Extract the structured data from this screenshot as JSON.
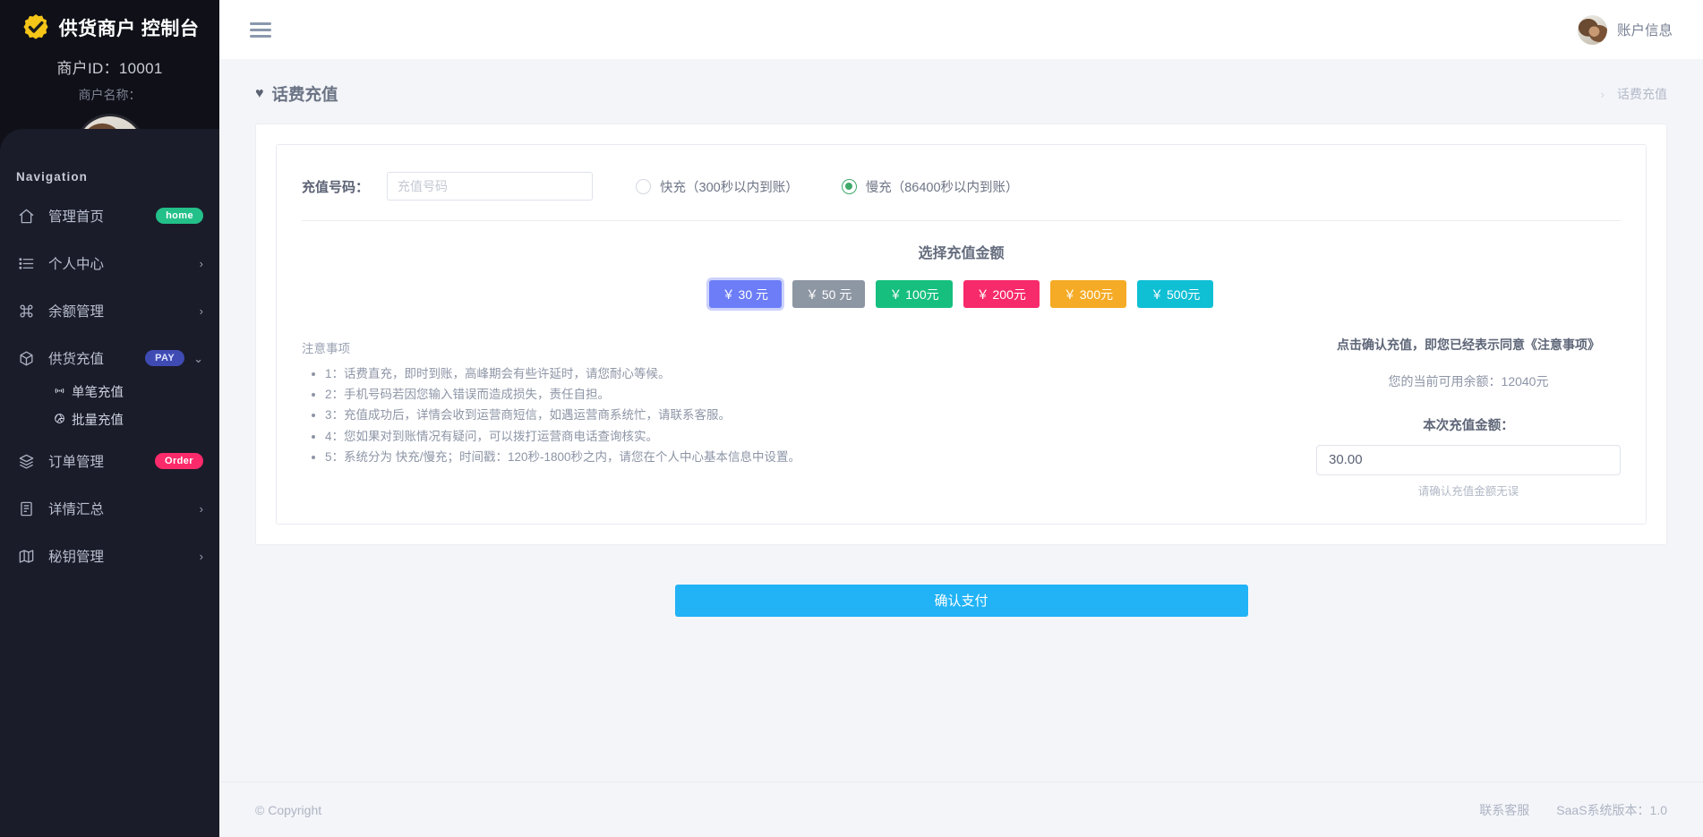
{
  "sidebar": {
    "brand_title": "供货商户 控制台",
    "logo_icon": "gear-check-icon",
    "merchant_id": "商户ID：10001",
    "merchant_name": "商户名称：",
    "nav_heading": "Navigation",
    "items": [
      {
        "label": "管理首页",
        "icon": "home-icon",
        "badge": "home",
        "badge_type": "home",
        "caret": ""
      },
      {
        "label": "个人中心",
        "icon": "list-icon",
        "badge": "",
        "badge_type": "",
        "caret": "›"
      },
      {
        "label": "余额管理",
        "icon": "command-icon",
        "badge": "",
        "badge_type": "",
        "caret": "›"
      },
      {
        "label": "供货充值",
        "icon": "box-icon",
        "badge": "PAY",
        "badge_type": "pay",
        "caret": "⌄"
      },
      {
        "label": "订单管理",
        "icon": "layers-icon",
        "badge": "Order",
        "badge_type": "order",
        "caret": ""
      },
      {
        "label": "详情汇总",
        "icon": "document-icon",
        "badge": "",
        "badge_type": "",
        "caret": "›"
      },
      {
        "label": "秘钥管理",
        "icon": "map-icon",
        "badge": "",
        "badge_type": "",
        "caret": "›"
      }
    ],
    "subitems": [
      {
        "label": "单笔充值",
        "glyph": "((↑))"
      },
      {
        "label": "批量充值",
        "glyph": "◎"
      }
    ]
  },
  "topbar": {
    "menu_icon": "hamburger-icon",
    "account_label": "账户信息",
    "avatar_icon": "user-avatar"
  },
  "page": {
    "title": "话费充值",
    "title_icon": "heart-icon",
    "breadcrumb_sep": "›",
    "breadcrumb_current": "话费充值"
  },
  "form": {
    "number_label": "充值号码：",
    "number_value": "",
    "number_placeholder": "充值号码",
    "speed_options": [
      {
        "label": "快充（300秒以内到账）",
        "checked": false
      },
      {
        "label": "慢充（86400秒以内到账）",
        "checked": true
      }
    ]
  },
  "amounts": {
    "heading": "选择充值金额",
    "buttons": [
      {
        "label": "￥ 30 元",
        "color": "#6c7df7",
        "selected": true
      },
      {
        "label": "￥ 50 元",
        "color": "#8d96a3",
        "selected": false
      },
      {
        "label": "￥ 100元",
        "color": "#17bf7f",
        "selected": false
      },
      {
        "label": "￥ 200元",
        "color": "#f72a6b",
        "selected": false
      },
      {
        "label": "￥ 300元",
        "color": "#f5ab25",
        "selected": false
      },
      {
        "label": "￥ 500元",
        "color": "#0fbfd4",
        "selected": false
      }
    ]
  },
  "notes": {
    "title": "注意事项",
    "items": [
      "1：话费直充，即时到账，高峰期会有些许延时，请您耐心等候。",
      "2：手机号码若因您输入错误而造成损失，责任自担。",
      "3：充值成功后，详情会收到运营商短信，如遇运营商系统忙，请联系客服。",
      "4：您如果对到账情况有疑问，可以拨打运营商电话查询核实。",
      "5：系统分为 快充/慢充；时间戳：120秒-1800秒之内，请您在个人中心基本信息中设置。"
    ]
  },
  "summary": {
    "agree_text": "点击确认充值，即您已经表示同意《注意事项》",
    "balance_text": "您的当前可用余额：12040元",
    "amount_label": "本次充值金额：",
    "amount_value": "30.00",
    "amount_hint": "请确认充值金额无误"
  },
  "pay": {
    "label": "确认支付",
    "color": "#21b3f6"
  },
  "footer": {
    "copyright": "© Copyright",
    "support_link": "联系客服",
    "version": "SaaS系统版本：1.0"
  }
}
